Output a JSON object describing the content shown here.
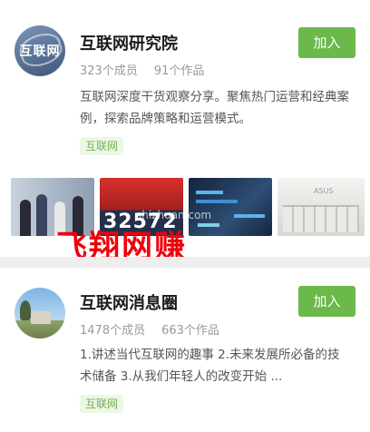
{
  "groups": [
    {
      "name": "互联网研究院",
      "members": "323个成员",
      "works": "91个作品",
      "description": "互联网深度干货观察分享。聚焦热门运营和经典案例，探索品牌策略和运营模式。",
      "tag": "互联网",
      "join_label": "加入",
      "avatar_text": "互联网",
      "thumbnail_number": "32572"
    },
    {
      "name": "互联网消息圈",
      "members": "1478个成员",
      "works": "663个作品",
      "description": "1.讲述当代互联网的趣事 2.未来发展所必备的技术储备 3.从我们年轻人的改变开始 ...",
      "tag": "互联网",
      "join_label": "加入"
    }
  ],
  "watermark": "飞翔网赚",
  "url_watermark": "shizhuan.com",
  "colors": {
    "accent": "#6bb84b",
    "tag_bg": "#edf7e6",
    "tag_text": "#76b052",
    "watermark": "#f0000c"
  }
}
